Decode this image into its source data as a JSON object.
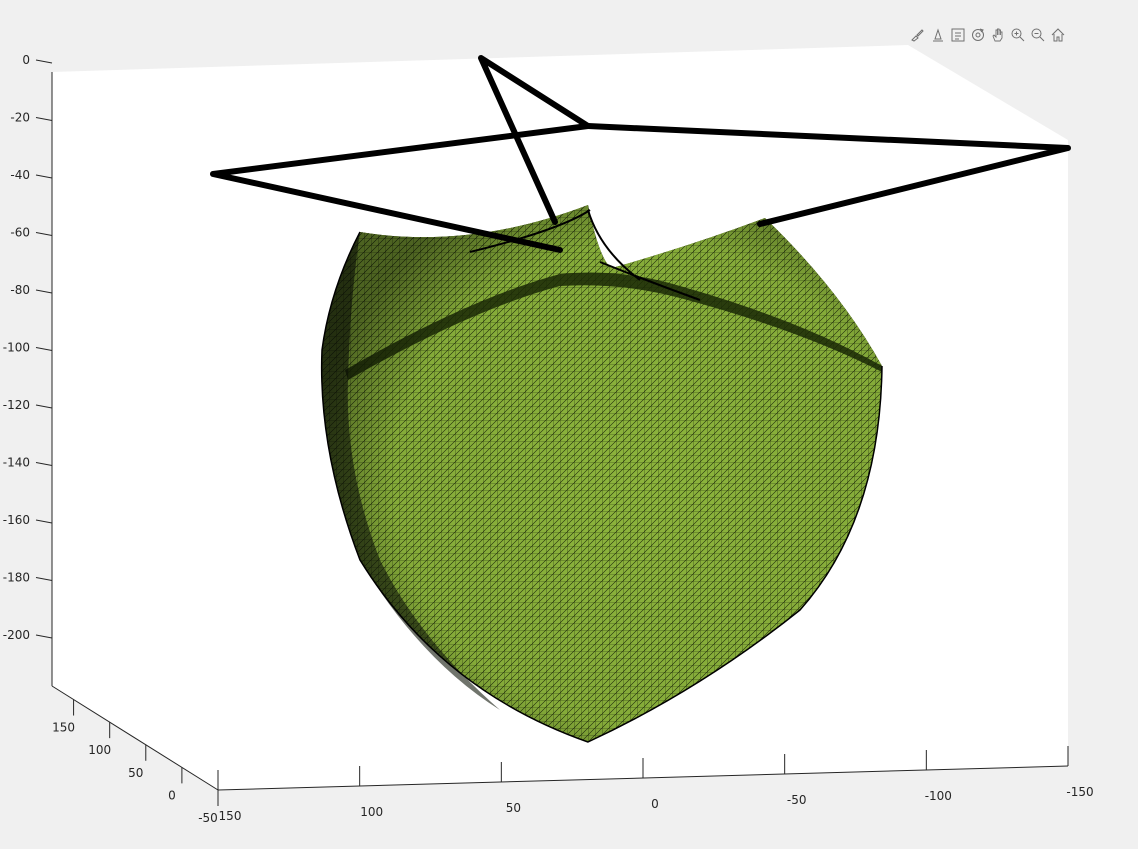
{
  "chart_data": {
    "type": "surface",
    "title": "",
    "xlabel": "",
    "ylabel": "",
    "zlabel": "",
    "xlim": [
      -150,
      150
    ],
    "ylim": [
      -50,
      150
    ],
    "zlim": [
      -225,
      0
    ],
    "x_ticks": [
      "150",
      "100",
      "50",
      "0",
      "-50",
      "-100",
      "-150"
    ],
    "y_ticks": [
      "-50",
      "0",
      "50",
      "100",
      "150"
    ],
    "z_ticks": [
      "0",
      "-20",
      "-40",
      "-60",
      "-80",
      "-100",
      "-120",
      "-140",
      "-160",
      "-180",
      "-200"
    ],
    "surface_color": "#8cb43c",
    "edge_color": "#000000",
    "frame_outline": {
      "description_points": [
        [
          150,
          0,
          -40
        ],
        [
          0,
          40,
          -22
        ],
        [
          -150,
          0,
          -30
        ],
        [
          0,
          0,
          -65
        ],
        [
          0,
          150,
          -5
        ],
        [
          0,
          20,
          -60
        ]
      ]
    },
    "grid": false
  },
  "toolbar": {
    "icons": [
      "brush-icon",
      "data-tips-icon",
      "legend-icon",
      "rotate-icon",
      "pan-icon",
      "zoom-in-icon",
      "zoom-out-icon",
      "home-icon"
    ]
  }
}
